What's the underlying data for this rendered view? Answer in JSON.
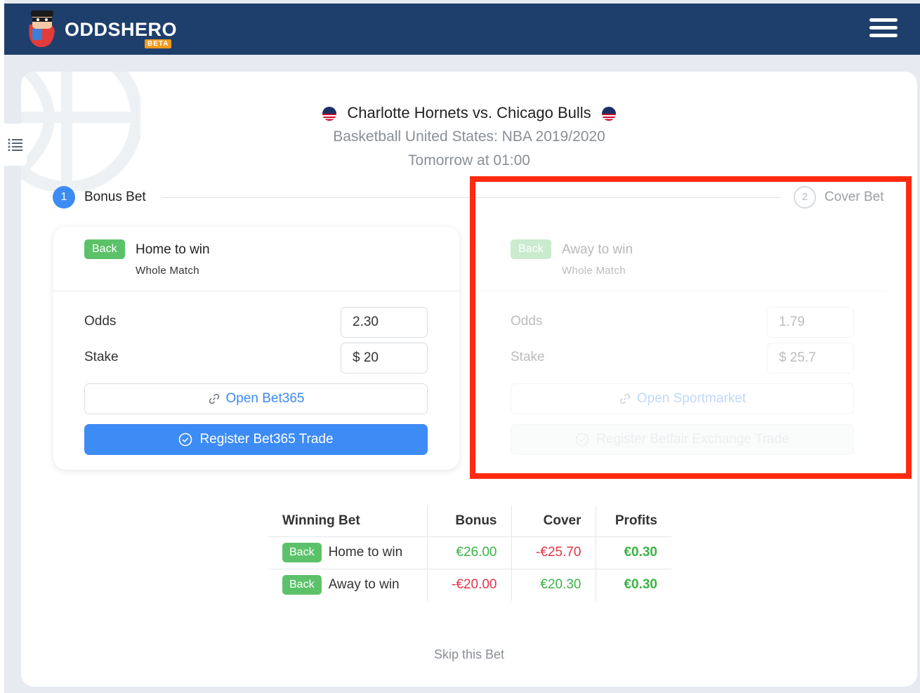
{
  "header": {
    "brand": "ODDSHERO",
    "beta": "BETA"
  },
  "match": {
    "title": "Charlotte Hornets vs. Chicago Bulls",
    "league": "Basketball United States: NBA 2019/2020",
    "time": "Tomorrow at 01:00"
  },
  "steps": {
    "step1_number": "1",
    "step1_label": "Bonus Bet",
    "step2_number": "2",
    "step2_label": "Cover Bet"
  },
  "bonus_bet": {
    "type": "Back",
    "selection": "Home to win",
    "market": "Whole Match",
    "odds_label": "Odds",
    "odds_value": "2.30",
    "stake_label": "Stake",
    "stake_value": "$ 20",
    "open_button": "Open Bet365",
    "register_button": "Register Bet365 Trade"
  },
  "cover_bet": {
    "type": "Back",
    "selection": "Away to win",
    "market": "Whole Match",
    "odds_label": "Odds",
    "odds_value": "1.79",
    "stake_label": "Stake",
    "stake_value": "$ 25.7",
    "open_button": "Open Sportmarket",
    "register_button": "Register Betfair Exchange Trade"
  },
  "summary": {
    "headers": [
      "Winning Bet",
      "Bonus",
      "Cover",
      "Profits"
    ],
    "rows": [
      {
        "type": "Back",
        "selection": "Home to win",
        "bonus": "€26.00",
        "cover": "-€25.70",
        "profit": "€0.30"
      },
      {
        "type": "Back",
        "selection": "Away to win",
        "bonus": "-€20.00",
        "cover": "€20.30",
        "profit": "€0.30"
      }
    ]
  },
  "skip_label": "Skip this Bet",
  "colors": {
    "header_bg": "#1e3f6b",
    "primary_blue": "#3d8bf5",
    "back_green": "#5cc26a",
    "positive": "#3cb446",
    "negative": "#e0364a",
    "highlight_red": "#ff2a10"
  }
}
